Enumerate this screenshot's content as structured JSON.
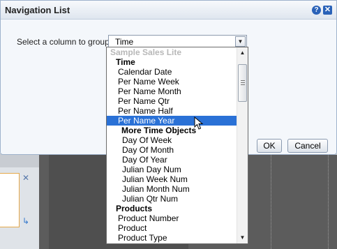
{
  "dialog": {
    "title": "Navigation List",
    "help_icon": "?",
    "close_icon": "✕",
    "group_label": "Select a column to group :",
    "selected_value": "Time",
    "ok_label": "OK",
    "cancel_label": "Cancel"
  },
  "dropdown": {
    "items": [
      {
        "label": "Sample Sales Lite",
        "kind": "disabled"
      },
      {
        "label": "Time",
        "kind": "group"
      },
      {
        "label": "Calendar Date",
        "kind": "item"
      },
      {
        "label": "Per Name Week",
        "kind": "item"
      },
      {
        "label": "Per Name Month",
        "kind": "item"
      },
      {
        "label": "Per Name Qtr",
        "kind": "item"
      },
      {
        "label": "Per Name Half",
        "kind": "item"
      },
      {
        "label": "Per Name Year",
        "kind": "selected"
      },
      {
        "label": "More Time Objects",
        "kind": "subgroup"
      },
      {
        "label": "Day Of Week",
        "kind": "sub"
      },
      {
        "label": "Day Of Month",
        "kind": "sub"
      },
      {
        "label": "Day Of Year",
        "kind": "sub"
      },
      {
        "label": "Julian Day Num",
        "kind": "sub"
      },
      {
        "label": "Julian Week Num",
        "kind": "sub"
      },
      {
        "label": "Julian Month Num",
        "kind": "sub"
      },
      {
        "label": "Julian Qtr Num",
        "kind": "sub"
      },
      {
        "label": "Products",
        "kind": "group"
      },
      {
        "label": "Product Number",
        "kind": "item"
      },
      {
        "label": "Product",
        "kind": "item"
      },
      {
        "label": "Product Type",
        "kind": "item"
      }
    ],
    "scroll_up_icon": "▲",
    "scroll_down_icon": "▼"
  },
  "icons": {
    "select_arrow": "▼",
    "bg_close": "✕",
    "bg_arrow": "↳"
  },
  "colors": {
    "selection": "#2a71d6",
    "title_icons": "#2a62b8"
  }
}
